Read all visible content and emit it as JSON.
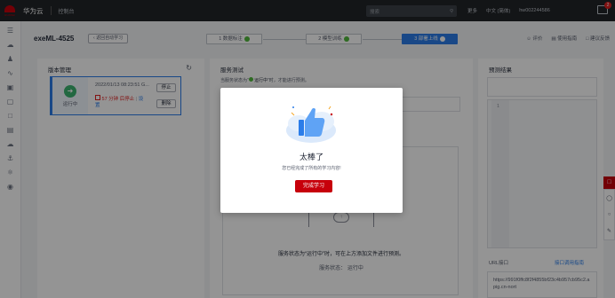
{
  "topbar": {
    "brand": "华为云",
    "console": "控制台",
    "search_placeholder": "搜索",
    "links": [
      "更多",
      "中文 (简体)",
      "hw002244586"
    ],
    "message_count": "2"
  },
  "header": {
    "project": "exeML-4525",
    "back": "返回自动学习",
    "steps": [
      "1 数据标注",
      "2 模型训练",
      "3 部署上线"
    ],
    "active_step": 2,
    "links": [
      "评价",
      "使用指南",
      "建议反馈"
    ]
  },
  "version_panel": {
    "title": "版本管理",
    "refresh_icon": "refresh-icon",
    "card": {
      "status": "运行中",
      "date": "2022/01/13 08:23:51 G...",
      "time_left": "57 分钟 后停止",
      "set_link": "设置",
      "stop_button": "停止",
      "delete_button": "删除"
    }
  },
  "service_panel": {
    "title": "服务测试",
    "hint_prefix": "当服务状态为“",
    "hint_status": "运行中",
    "hint_suffix": "”时，才能进行预测。",
    "upload_text": "服务状态为“运行中”时，可在上方添加文件进行预测。",
    "service_status": "服务状态：  运行中"
  },
  "result_panel": {
    "title": "预测结果",
    "line_number": "1",
    "url_label": "URL接口",
    "url_link": "接口调用指南",
    "url_value": "https://991f0ffc8f2f4855bf23c4b957cb95c2.apig.cn-nort"
  },
  "modal": {
    "title": "太棒了",
    "description": "您已经完成了所有的学习内容!",
    "button": "完成学习"
  },
  "colors": {
    "brand_red": "#c7000b",
    "accent_blue": "#2b7de9",
    "success_green": "#50b83c"
  }
}
